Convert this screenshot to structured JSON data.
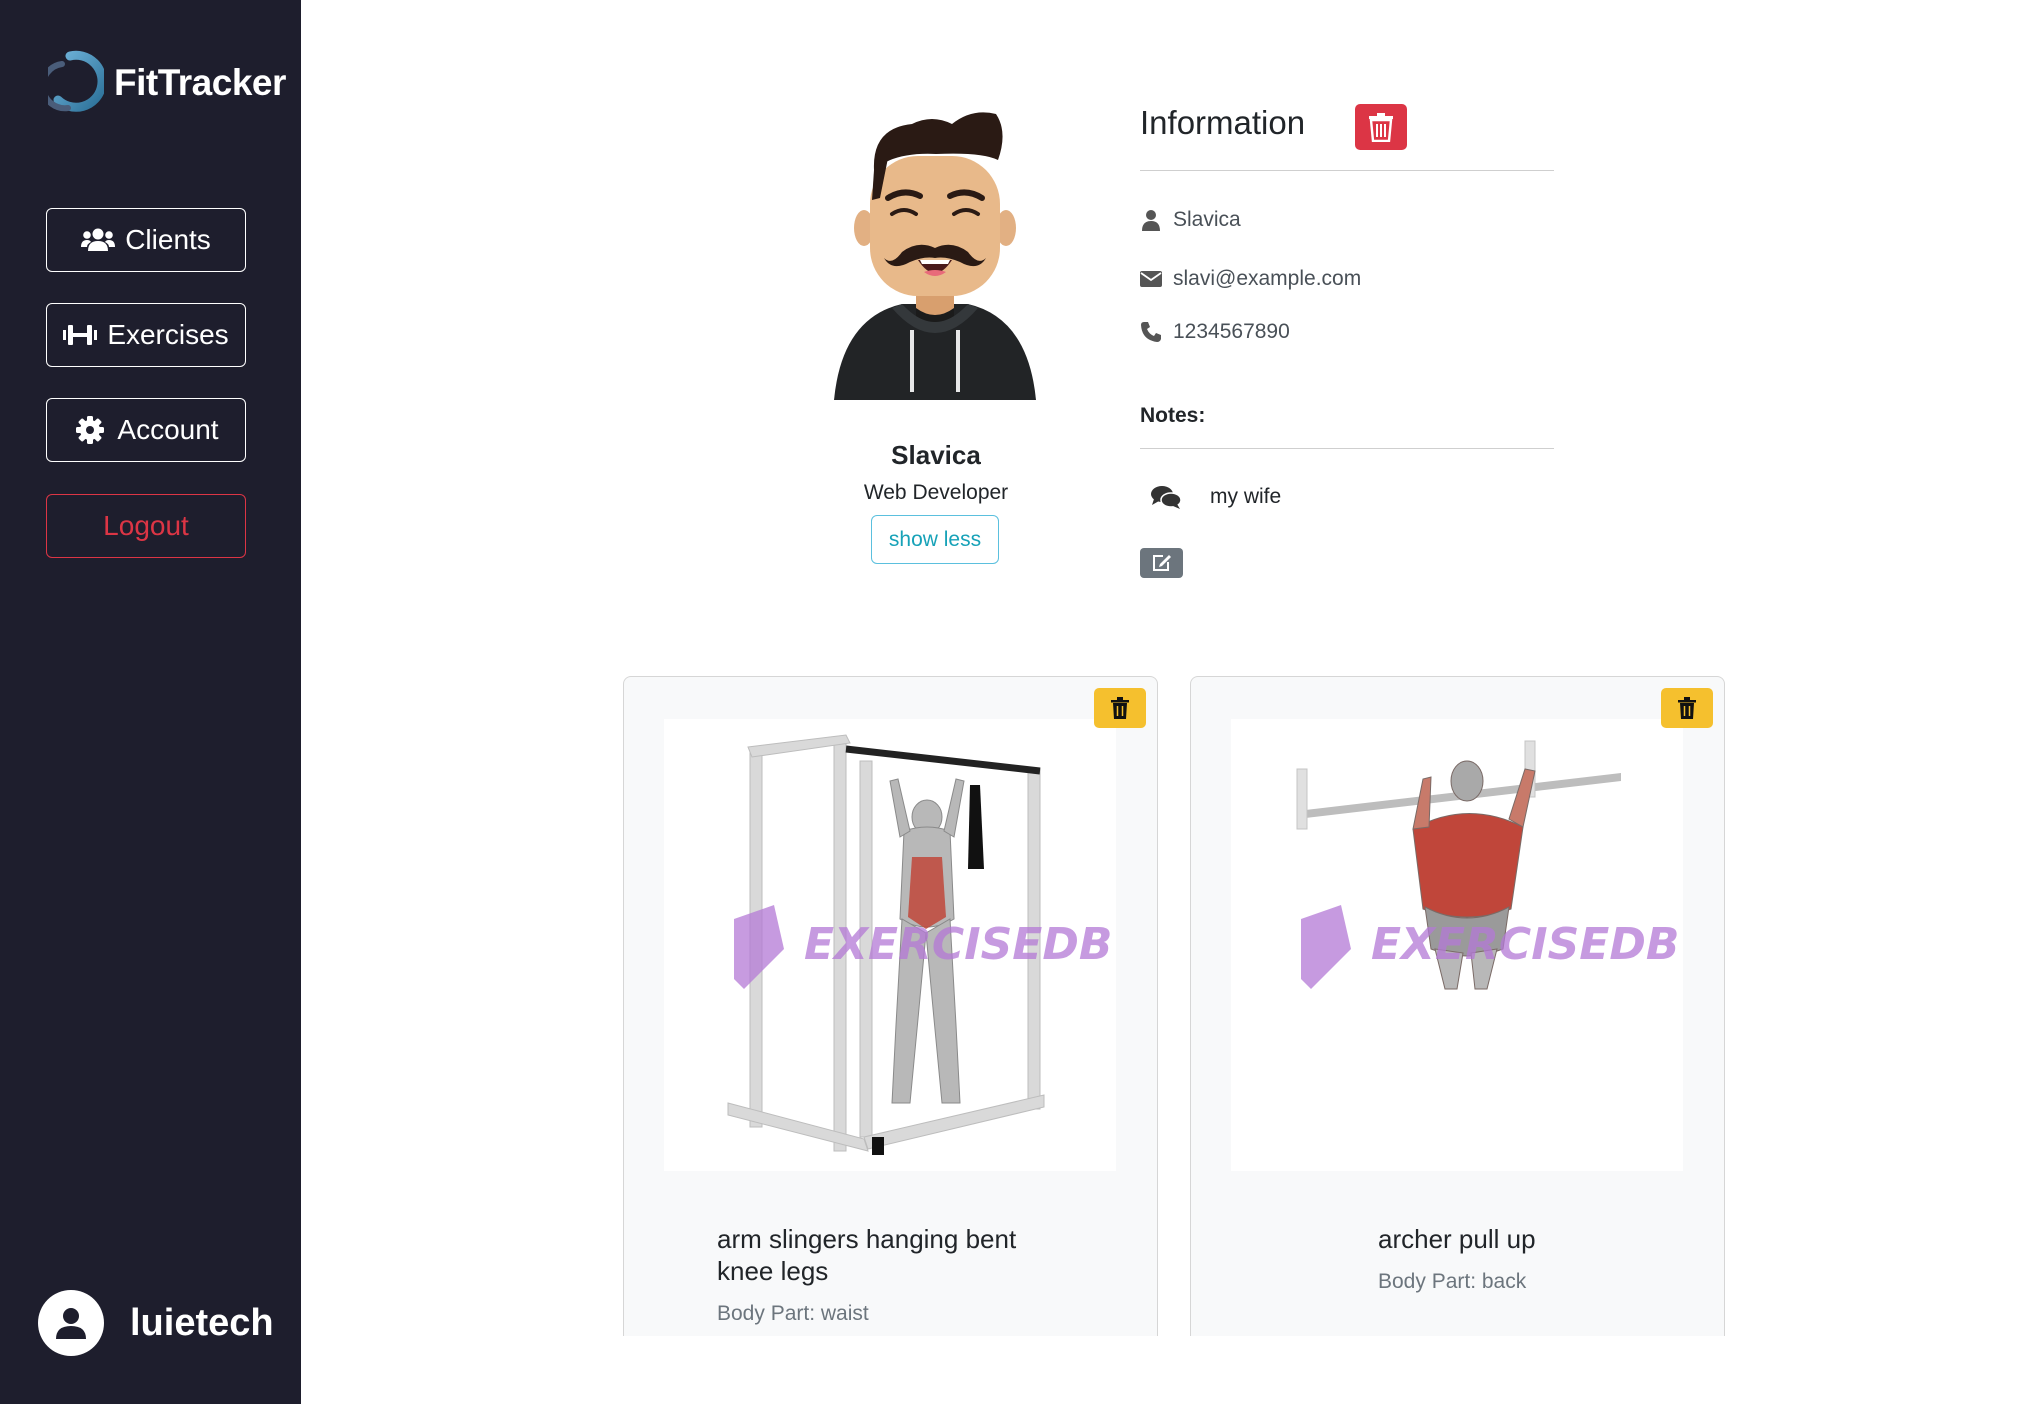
{
  "app": {
    "brand_name": "FitTracker",
    "logo_icon": "ring-logo-icon"
  },
  "sidebar": {
    "items": [
      {
        "label": "Clients",
        "icon": "users-icon"
      },
      {
        "label": "Exercises",
        "icon": "dumbbell-icon"
      },
      {
        "label": "Account",
        "icon": "gear-icon"
      },
      {
        "label": "Logout"
      }
    ],
    "user": {
      "name": "luietech",
      "icon": "user-avatar-icon"
    }
  },
  "profile": {
    "name": "Slavica",
    "title": "Web Developer",
    "toggle_label": "show less"
  },
  "information": {
    "heading": "Information",
    "name": "Slavica",
    "email": "slavi@example.com",
    "phone": "1234567890",
    "notes_label": "Notes:",
    "notes": [
      {
        "text": "my wife"
      }
    ]
  },
  "exercises": [
    {
      "name": "arm slingers hanging bent knee legs",
      "body_part": "Body Part: waist",
      "watermark": "EXERCISEDB"
    },
    {
      "name": "archer pull up",
      "body_part": "Body Part: back",
      "watermark": "EXERCISEDB"
    }
  ],
  "colors": {
    "sidebar_bg": "#1e1e2d",
    "danger": "#dc3545",
    "warning": "#f5c02e",
    "info": "#17a2b8",
    "secondary": "#6c757d"
  }
}
